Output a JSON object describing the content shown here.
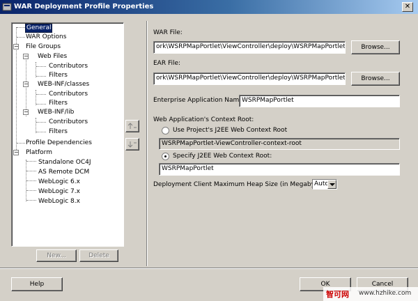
{
  "window": {
    "title": "WAR Deployment Profile Properties"
  },
  "tree": {
    "items": [
      {
        "label": "General",
        "selected": true
      },
      {
        "label": "WAR Options"
      },
      {
        "label": "File Groups"
      },
      {
        "label": "Web Files"
      },
      {
        "label": "Contributors"
      },
      {
        "label": "Filters"
      },
      {
        "label": "WEB-INF/classes"
      },
      {
        "label": "Contributors"
      },
      {
        "label": "Filters"
      },
      {
        "label": "WEB-INF/lib"
      },
      {
        "label": "Contributors"
      },
      {
        "label": "Filters"
      },
      {
        "label": "Profile Dependencies"
      },
      {
        "label": "Platform"
      },
      {
        "label": "Standalone OC4J"
      },
      {
        "label": "AS Remote DCM"
      },
      {
        "label": "WebLogic 6.x"
      },
      {
        "label": "WebLogic 7.x"
      },
      {
        "label": "WebLogic 8.x"
      }
    ]
  },
  "left_buttons": {
    "new_label": "New...",
    "delete_label": "Delete"
  },
  "form": {
    "war_file_label": "WAR File:",
    "war_file_value": "ork\\WSRPMapPortlet\\ViewController\\deploy\\WSRPMapPortlet.war",
    "ear_file_label": "EAR File:",
    "ear_file_value": "ork\\WSRPMapPortlet\\ViewController\\deploy\\WSRPMapPortlet.ear",
    "browse_label": "Browse...",
    "enterprise_app_label": "Enterprise Application Name:",
    "enterprise_app_value": "WSRPMapPortlet",
    "context_root_label": "Web Application's Context Root:",
    "radio_project_label": "Use Project's J2EE Web Context Root",
    "project_root_value": "WSRPMapPortlet-ViewController-context-root",
    "radio_specify_label": "Specify J2EE Web Context Root:",
    "specify_root_value": "WSRPMapPortlet",
    "heap_label": "Deployment Client Maximum Heap Size (in Megabytes):",
    "heap_value": "Auto"
  },
  "footer": {
    "help_label": "Help",
    "ok_label": "OK",
    "cancel_label": "Cancel"
  },
  "watermark": {
    "brand": "智可网",
    "url": "www.hzhike.com"
  }
}
